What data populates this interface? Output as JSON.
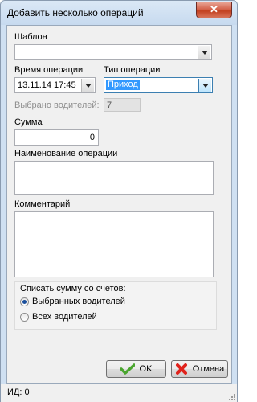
{
  "window": {
    "title": "Добавить несколько операций",
    "close_glyph": "✕"
  },
  "form": {
    "template_label": "Шаблон",
    "template_value": "",
    "time_label": "Время операции",
    "time_value": "13.11.14 17:45",
    "type_label": "Тип операции",
    "type_value": "Приход",
    "drivers_label": "Выбрано водителей:",
    "drivers_value": "7",
    "amount_label": "Сумма",
    "amount_value": "0",
    "name_label": "Наименование операции",
    "name_value": "",
    "comment_label": "Комментарий",
    "comment_value": ""
  },
  "group": {
    "title": "Списать сумму со счетов:",
    "options": [
      {
        "label": "Выбранных водителей",
        "selected": true
      },
      {
        "label": "Всех водителей",
        "selected": false
      }
    ]
  },
  "buttons": {
    "ok": "OK",
    "cancel": "Отмена"
  },
  "statusbar": {
    "text": "ИД: 0"
  },
  "icons": {
    "ok": "checkmark-icon",
    "cancel": "red-x-icon",
    "dropdown": "chevron-down-icon"
  },
  "colors": {
    "ok_icon": "#4aa52e",
    "cancel_icon": "#e0221b",
    "selection": "#3399ff"
  }
}
